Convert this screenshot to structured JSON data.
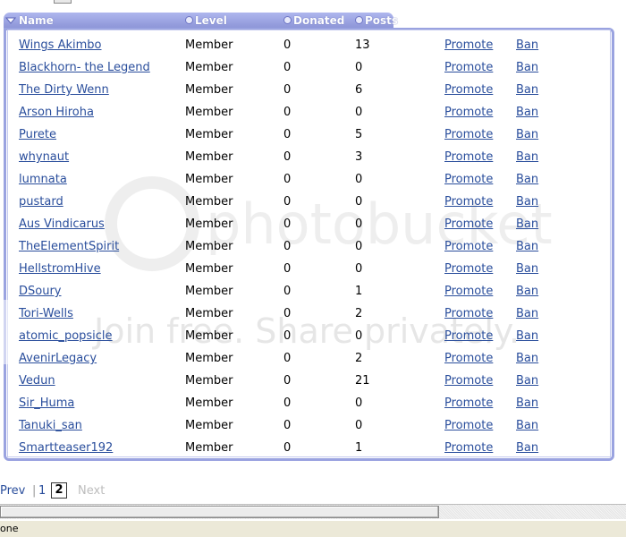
{
  "columns": {
    "name": "Name",
    "level": "Level",
    "donated": "Donated",
    "posts": "Posts"
  },
  "actions": {
    "promote": "Promote",
    "ban": "Ban"
  },
  "members": [
    {
      "name": "Wings Akimbo",
      "level": "Member",
      "donated": "0",
      "posts": "13"
    },
    {
      "name": "Blackhorn- the Legend",
      "level": "Member",
      "donated": "0",
      "posts": "0"
    },
    {
      "name": "The Dirty Wenn",
      "level": "Member",
      "donated": "0",
      "posts": "6"
    },
    {
      "name": "Arson Hiroha",
      "level": "Member",
      "donated": "0",
      "posts": "0"
    },
    {
      "name": "Purete",
      "level": "Member",
      "donated": "0",
      "posts": "5"
    },
    {
      "name": "whynaut",
      "level": "Member",
      "donated": "0",
      "posts": "3"
    },
    {
      "name": "lumnata",
      "level": "Member",
      "donated": "0",
      "posts": "0"
    },
    {
      "name": "pustard",
      "level": "Member",
      "donated": "0",
      "posts": "0"
    },
    {
      "name": "Aus Vindicarus",
      "level": "Member",
      "donated": "0",
      "posts": "0"
    },
    {
      "name": "TheElementSpirit",
      "level": "Member",
      "donated": "0",
      "posts": "0"
    },
    {
      "name": "HellstromHive",
      "level": "Member",
      "donated": "0",
      "posts": "0"
    },
    {
      "name": "DSoury",
      "level": "Member",
      "donated": "0",
      "posts": "1"
    },
    {
      "name": "Tori-Wells",
      "level": "Member",
      "donated": "0",
      "posts": "2"
    },
    {
      "name": "atomic_popsicle",
      "level": "Member",
      "donated": "0",
      "posts": "0"
    },
    {
      "name": "AvenirLegacy",
      "level": "Member",
      "donated": "0",
      "posts": "2"
    },
    {
      "name": "Vedun",
      "level": "Member",
      "donated": "0",
      "posts": "21"
    },
    {
      "name": "Sir_Huma",
      "level": "Member",
      "donated": "0",
      "posts": "0"
    },
    {
      "name": "Tanuki_san",
      "level": "Member",
      "donated": "0",
      "posts": "0"
    },
    {
      "name": "Smartteaser192",
      "level": "Member",
      "donated": "0",
      "posts": "1"
    }
  ],
  "pager": {
    "prev": "Prev",
    "separator": "|",
    "page1": "1",
    "current": "2",
    "next": "Next"
  },
  "watermark": {
    "text": "Join free. Share privately."
  },
  "status": {
    "text": "one"
  },
  "colors": {
    "header": "#9aa3e0",
    "link": "#2a4e9c"
  }
}
